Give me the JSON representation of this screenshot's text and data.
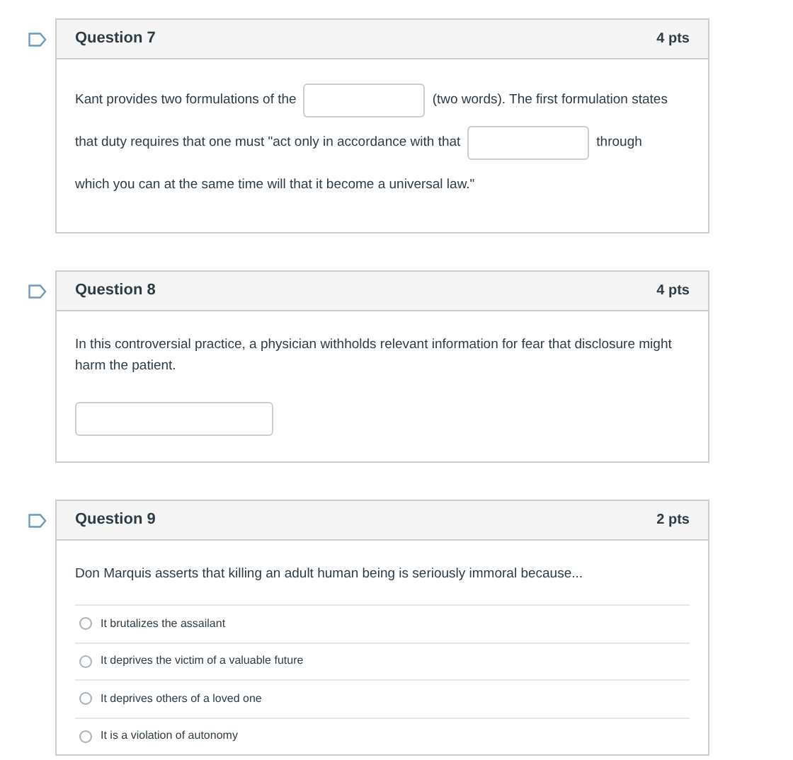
{
  "questions": [
    {
      "kind": "fill_blanks",
      "title": "Question 7",
      "points": "4 pts",
      "lines": [
        [
          {
            "kind": "text",
            "text": "Kant provides two formulations of the"
          },
          {
            "kind": "blank"
          },
          {
            "kind": "text",
            "text": "(two words). The first formulation states"
          }
        ],
        [
          {
            "kind": "text",
            "text": "that duty requires that one must \"act only in accordance with that"
          },
          {
            "kind": "blank"
          },
          {
            "kind": "text",
            "text": "through"
          }
        ],
        [
          {
            "kind": "text",
            "text": "which you can at the same time will that it become a universal law.\""
          }
        ]
      ]
    },
    {
      "kind": "short_answer",
      "title": "Question 8",
      "points": "4 pts",
      "prompt": "In this controversial practice, a physician withholds relevant information for fear that disclosure might harm the patient."
    },
    {
      "kind": "multiple_choice",
      "title": "Question 9",
      "points": "2 pts",
      "prompt": "Don Marquis asserts that killing an adult human being is seriously immoral because...",
      "options": [
        {
          "label": "It brutalizes the assailant",
          "selected": false
        },
        {
          "label": "It deprives the victim of a valuable future",
          "selected": false
        },
        {
          "label": "It deprives others of a loved one",
          "selected": false
        },
        {
          "label": "It is a violation of autonomy",
          "selected": false
        }
      ]
    }
  ]
}
